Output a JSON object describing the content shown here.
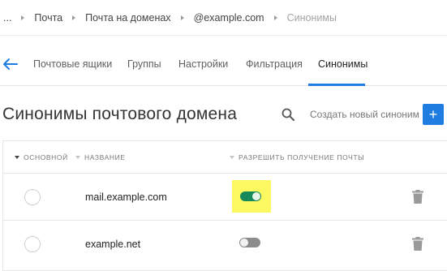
{
  "breadcrumb": {
    "items": [
      "...",
      "Почта",
      "Почта на доменах",
      "@example.com",
      "Синонимы"
    ]
  },
  "tabs": {
    "back_icon": "arrow-left-icon",
    "items": [
      {
        "label": "Почтовые ящики",
        "active": false
      },
      {
        "label": "Группы",
        "active": false
      },
      {
        "label": "Настройки",
        "active": false
      },
      {
        "label": "Фильтрация",
        "active": false
      },
      {
        "label": "Синонимы",
        "active": true
      }
    ]
  },
  "header": {
    "title": "Синонимы почтового домена",
    "search_icon": "search-icon",
    "create_label": "Создать новый синоним",
    "add_label": "+"
  },
  "table": {
    "columns": [
      {
        "label": "Основной",
        "sort": "active"
      },
      {
        "label": "Название",
        "sort": "inactive"
      },
      {
        "label": "Разрешить получение почты",
        "sort": "inactive"
      }
    ],
    "rows": [
      {
        "primary": false,
        "name": "mail.example.com",
        "allow_mail": true,
        "highlighted": true
      },
      {
        "primary": false,
        "name": "example.net",
        "allow_mail": false,
        "highlighted": false
      }
    ]
  },
  "colors": {
    "accent": "#1f7ce0",
    "toggle_on": "#178a5c",
    "toggle_off": "#8c8c8c",
    "highlight": "#fcf860"
  }
}
